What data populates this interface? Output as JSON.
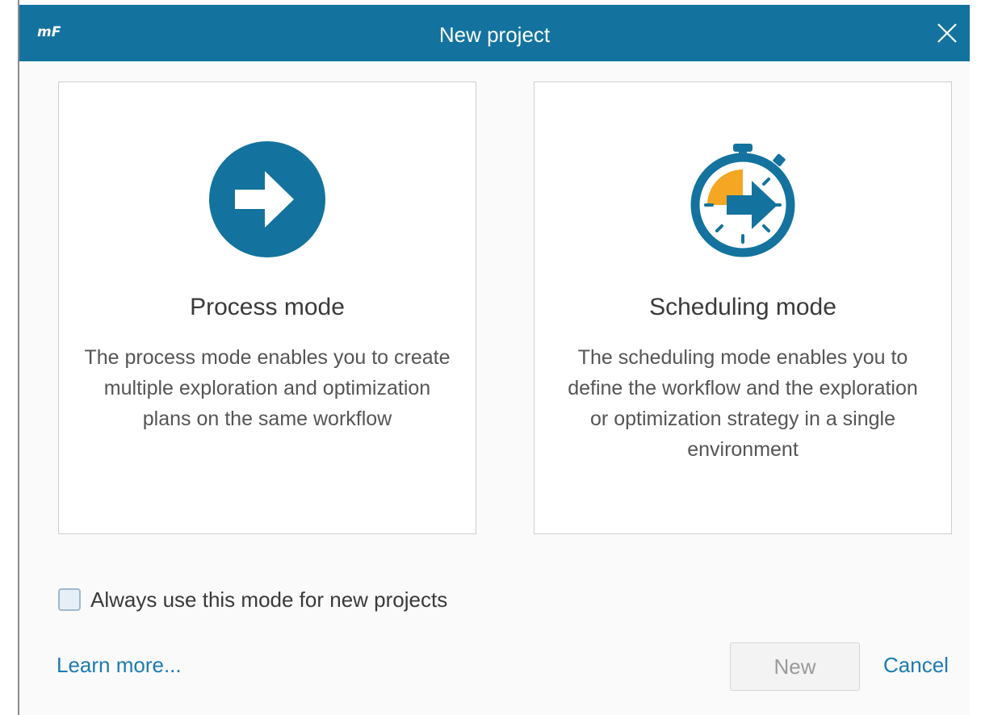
{
  "window": {
    "logo_text": "mF",
    "title": "New project",
    "close_icon": "close-icon"
  },
  "modes": [
    {
      "title": "Process mode",
      "description": "The process mode enables you to create multiple exploration and optimization plans on the same workflow",
      "icon": "arrow-circle-icon"
    },
    {
      "title": "Scheduling mode",
      "description": "The scheduling mode enables you to define the workflow and the exploration or optimization strategy in a single environment",
      "icon": "stopwatch-arrow-icon"
    }
  ],
  "options": {
    "remember_label": "Always use this mode for new projects",
    "remember_checked": false
  },
  "footer": {
    "learn_more": "Learn more...",
    "new_label": "New",
    "new_enabled": false,
    "cancel_label": "Cancel"
  },
  "colors": {
    "accent": "#13739e",
    "orange": "#f5a623",
    "link": "#1c7bb0"
  }
}
